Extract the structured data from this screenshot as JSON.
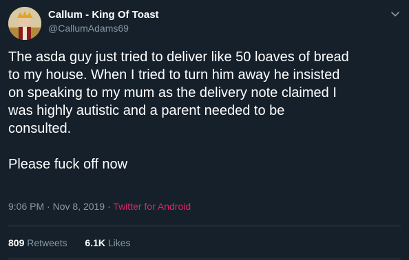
{
  "user": {
    "display_name": "Callum - King Of Toast",
    "handle": "@CallumAdams69"
  },
  "icons": {
    "menu": "chevron-down-icon",
    "avatar": "avatar"
  },
  "tweet": {
    "text": "The asda guy just tried to deliver like 50 loaves of bread\nto my house. When I tried to turn him away he insisted\non speaking to my mum as the delivery note claimed I\nwas highly autistic and a parent needed to be\nconsulted.\n\nPlease fuck off now",
    "time": "9:06 PM",
    "separator": "·",
    "date": "Nov 8, 2019",
    "source": "Twitter for Android"
  },
  "stats": {
    "retweets_count": "809",
    "retweets_label": "Retweets",
    "likes_count": "6.1K",
    "likes_label": "Likes"
  },
  "colors": {
    "background": "#15202b",
    "secondary_text": "#8899a6",
    "source_link": "#e0245e",
    "divider": "#38444d"
  }
}
